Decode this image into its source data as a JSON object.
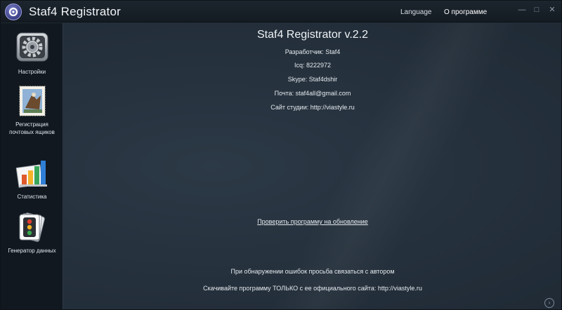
{
  "titlebar": {
    "title": "Staf4 Registrator",
    "menu": {
      "language": "Language",
      "about": "О программе"
    }
  },
  "sidebar": {
    "items": [
      {
        "label": "Настройки",
        "icon": "settings-gear-icon"
      },
      {
        "label": "Регистрация почтовых ящиков",
        "icon": "mail-stamp-icon"
      },
      {
        "label": "Статистика",
        "icon": "bar-chart-icon"
      },
      {
        "label": "Генератор данных",
        "icon": "cards-generator-icon"
      }
    ]
  },
  "about": {
    "heading": "Staf4 Registrator v.2.2",
    "developer": "Разработчик: Staf4",
    "icq": "Icq: 8222972",
    "skype": "Skype: Staf4dshir",
    "email": "Почта: staf4all@gmail.com",
    "site": "Сайт студии: http://viastyle.ru",
    "update_link": "Проверить программу на обновление",
    "notice_errors": "При обнаружении ошибок просьба связаться с автором",
    "notice_download": "Скачивайте программу ТОЛЬКО с ее официального сайта: http://viastyle.ru"
  },
  "colors": {
    "background": "#26323e",
    "sidebar": "#111820",
    "titlebar": "#161d24",
    "text": "#e8eef4"
  }
}
